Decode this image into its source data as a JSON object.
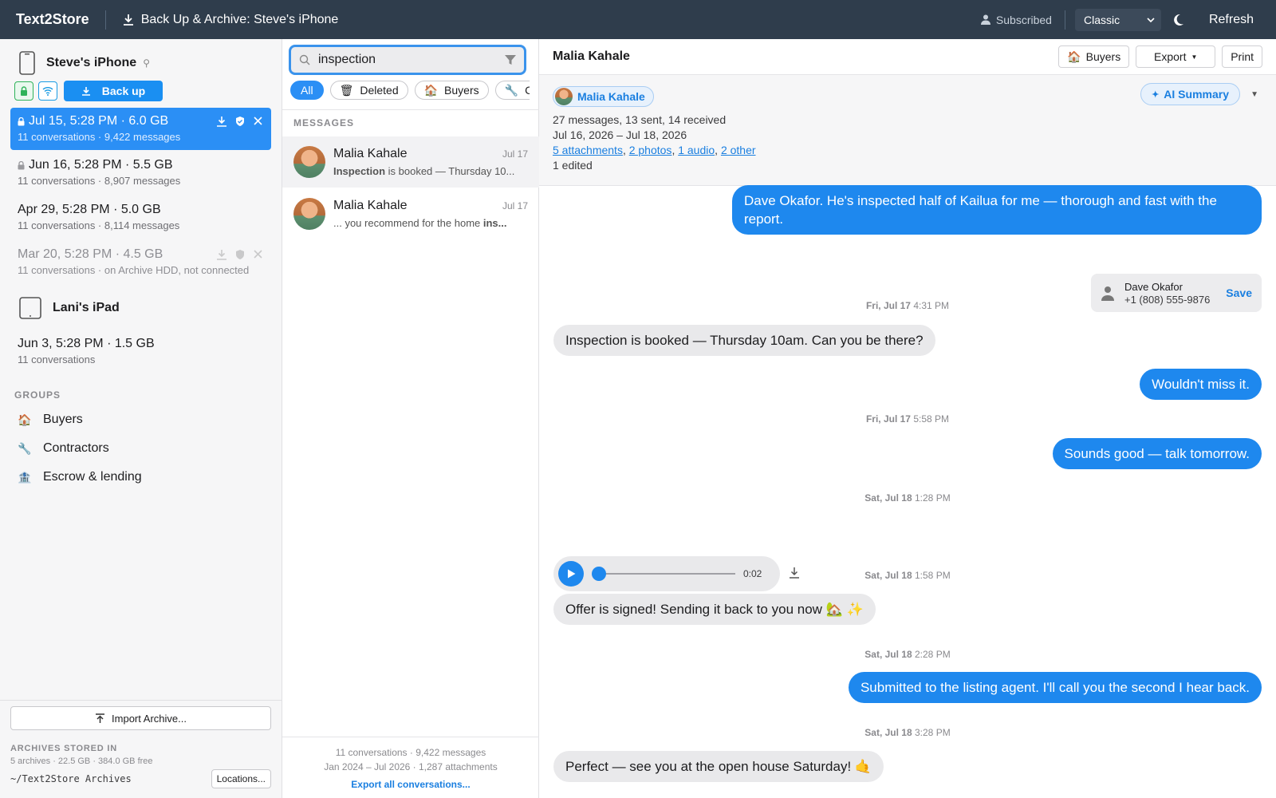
{
  "topbar": {
    "brand": "Text2Store",
    "action_label": "Back Up & Archive: Steve's iPhone",
    "subscribed_label": "Subscribed",
    "theme_value": "Classic",
    "refresh_label": "Refresh"
  },
  "sidebar": {
    "devices": [
      {
        "name": "Steve's iPhone",
        "backup_label": "Back up",
        "archives": [
          {
            "title": "Jul 15, 5:28 PM · 6.0 GB",
            "sub": "11 conversations · 9,422 messages"
          },
          {
            "title": "Jun 16, 5:28 PM · 5.5 GB",
            "sub": "11 conversations · 8,907 messages"
          },
          {
            "title": "Apr 29, 5:28 PM · 5.0 GB",
            "sub": "11 conversations · 8,114 messages"
          },
          {
            "title": "Mar 20, 5:28 PM · 4.5 GB",
            "sub": "11 conversations · on Archive HDD, not connected"
          }
        ]
      },
      {
        "name": "Lani's iPad",
        "archives": [
          {
            "title": "Jun 3, 5:28 PM · 1.5 GB",
            "sub": "11 conversations"
          }
        ]
      }
    ],
    "groups_label": "GROUPS",
    "groups": [
      {
        "icon": "🏠",
        "label": "Buyers"
      },
      {
        "icon": "🔧",
        "label": "Contractors"
      },
      {
        "icon": "🏦",
        "label": "Escrow & lending"
      }
    ],
    "import_label": "Import Archive...",
    "stored_label": "ARCHIVES STORED IN",
    "stored_sub": "5 archives · 22.5 GB · 384.0 GB free",
    "stored_path": "~/Text2Store Archives",
    "locations_label": "Locations..."
  },
  "middle": {
    "search_value": "inspection",
    "chips": [
      {
        "icon": "",
        "label": "All"
      },
      {
        "icon": "🗑",
        "label": "Deleted"
      },
      {
        "icon": "🏠",
        "label": "Buyers"
      },
      {
        "icon": "🔧",
        "label": "Co"
      }
    ],
    "section_label": "MESSAGES",
    "results": [
      {
        "name": "Malia Kahale",
        "date": "Jul 17",
        "snippet_bold": "Inspection",
        "snippet_rest": " is booked — Thursday 10..."
      },
      {
        "name": "Malia Kahale",
        "date": "Jul 17",
        "snippet_pre": "... you recommend for the home ",
        "snippet_bold": "ins..."
      }
    ],
    "footer_line1": "11 conversations · 9,422 messages",
    "footer_line2": "Jan 2024 – Jul 2026 · 1,287 attachments",
    "footer_link": "Export all conversations..."
  },
  "conversation": {
    "title": "Malia Kahale",
    "buttons": {
      "buyers": "Buyers",
      "export": "Export",
      "print": "Print"
    },
    "contact_pill": "Malia Kahale",
    "ai_summary": "AI Summary",
    "stats": "27 messages, 13 sent, 14 received",
    "date_range": "Jul 16, 2026 – Jul 18, 2026",
    "attachment_links": [
      "5 attachments",
      "2 photos",
      "1 audio",
      "2 other"
    ],
    "edited": "1 edited",
    "messages": [
      {
        "text": "Dave Okafor. He's inspected half of Kailua for me — thorough and fast with the report."
      },
      {
        "text": "Inspection is booked — Thursday 10am. Can you be there?"
      },
      {
        "text": "Wouldn't miss it."
      },
      {
        "text": "Sounds good — talk tomorrow."
      },
      {
        "text": "Offer is signed! Sending it back to you now 🏡 ✨"
      },
      {
        "text": "Submitted to the listing agent. I'll call you the second I hear back."
      },
      {
        "text": "Perfect — see you at the open house Saturday! 🤙"
      }
    ],
    "timestamps": [
      {
        "day": "Fri, Jul 17",
        "time": "4:31 PM"
      },
      {
        "day": "Fri, Jul 17",
        "time": "5:58 PM"
      },
      {
        "day": "Sat, Jul 18",
        "time": "1:28 PM"
      },
      {
        "day": "Sat, Jul 18",
        "time": "1:58 PM"
      },
      {
        "day": "Sat, Jul 18",
        "time": "2:28 PM"
      },
      {
        "day": "Sat, Jul 18",
        "time": "3:28 PM"
      }
    ],
    "contact_card": {
      "name": "Dave Okafor",
      "number": "+1 (808) 555-9876",
      "save_label": "Save"
    },
    "audio": {
      "duration": "0:02",
      "progress": 0
    }
  },
  "colors": {
    "topbar": "#2f3d4c",
    "accent": "#1e88ee",
    "incoming_bubble": "#e9e9eb"
  }
}
